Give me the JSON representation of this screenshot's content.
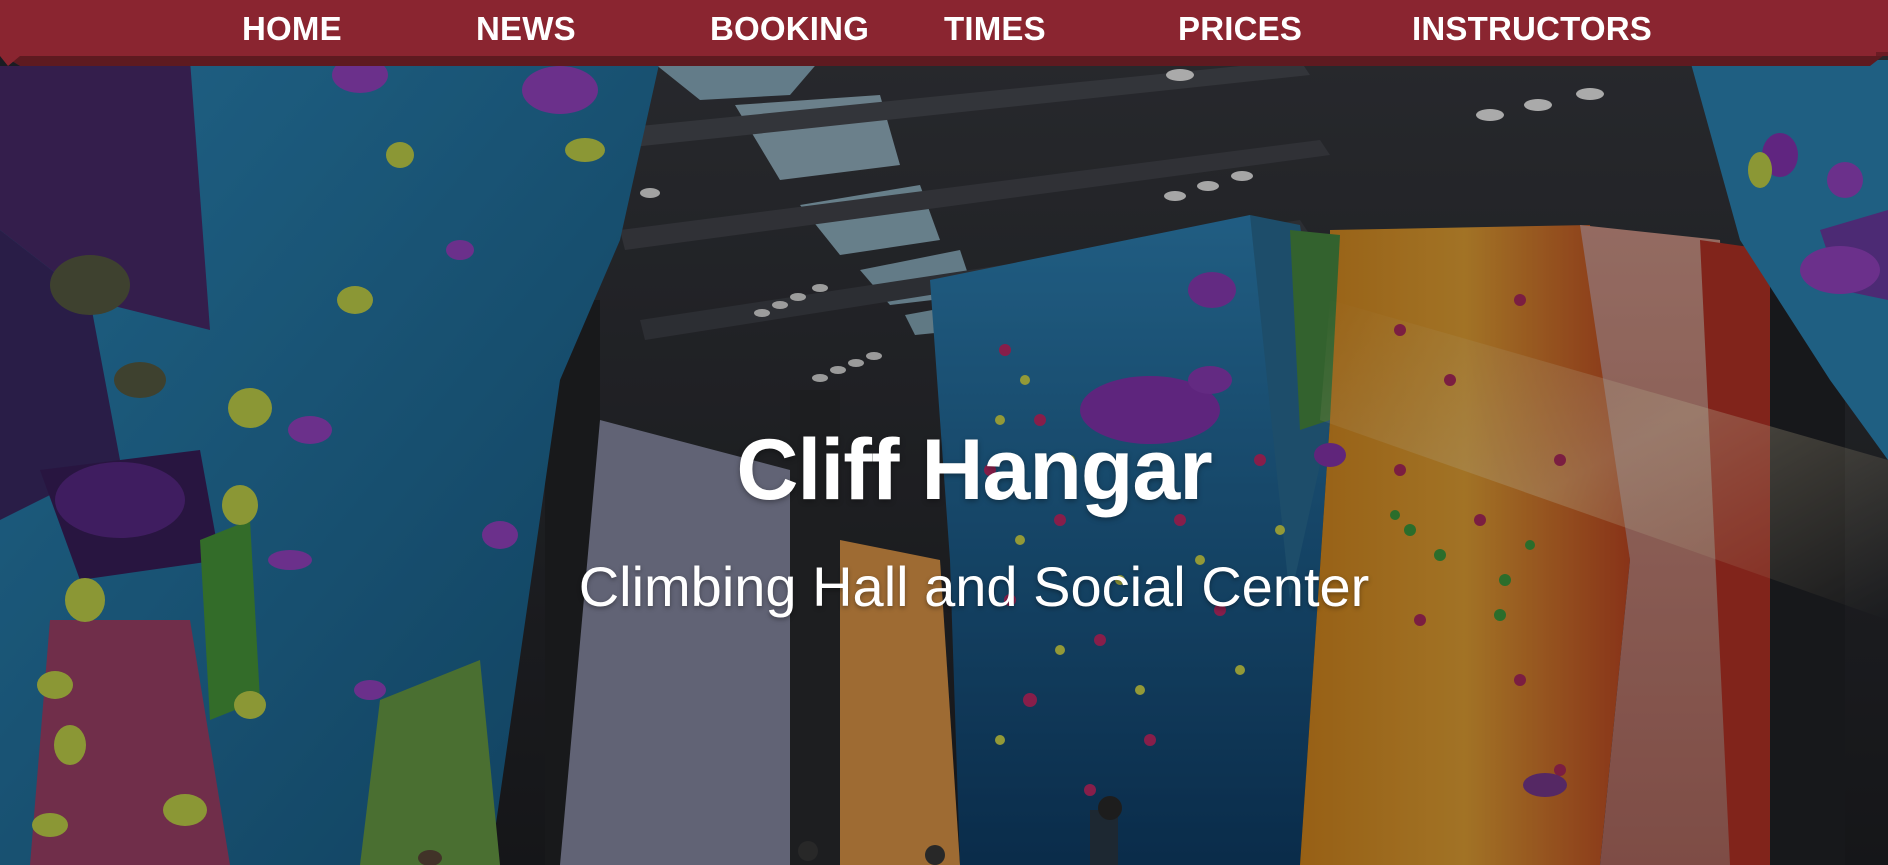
{
  "nav": {
    "items": [
      {
        "label": "HOME"
      },
      {
        "label": "NEWS"
      },
      {
        "label": "BOOKING"
      },
      {
        "label": "TIMES"
      },
      {
        "label": "PRICES"
      },
      {
        "label": "INSTRUCTORS"
      }
    ],
    "bar_color": "#8a2530",
    "shadow_color": "#5e1a20"
  },
  "hero": {
    "title": "Cliff Hangar",
    "subtitle": "Climbing Hall and Social Center",
    "image": "climbing-hall-image"
  },
  "colors": {
    "text": "#ffffff",
    "wall_blue": "#2a7fb0",
    "wall_purple": "#4c2a70",
    "wall_orange": "#d77a1c",
    "wall_yellow": "#e0b340",
    "wall_red": "#b5322a",
    "hold_purple": "#8a35b8",
    "hold_yellow": "#c9d84a"
  }
}
